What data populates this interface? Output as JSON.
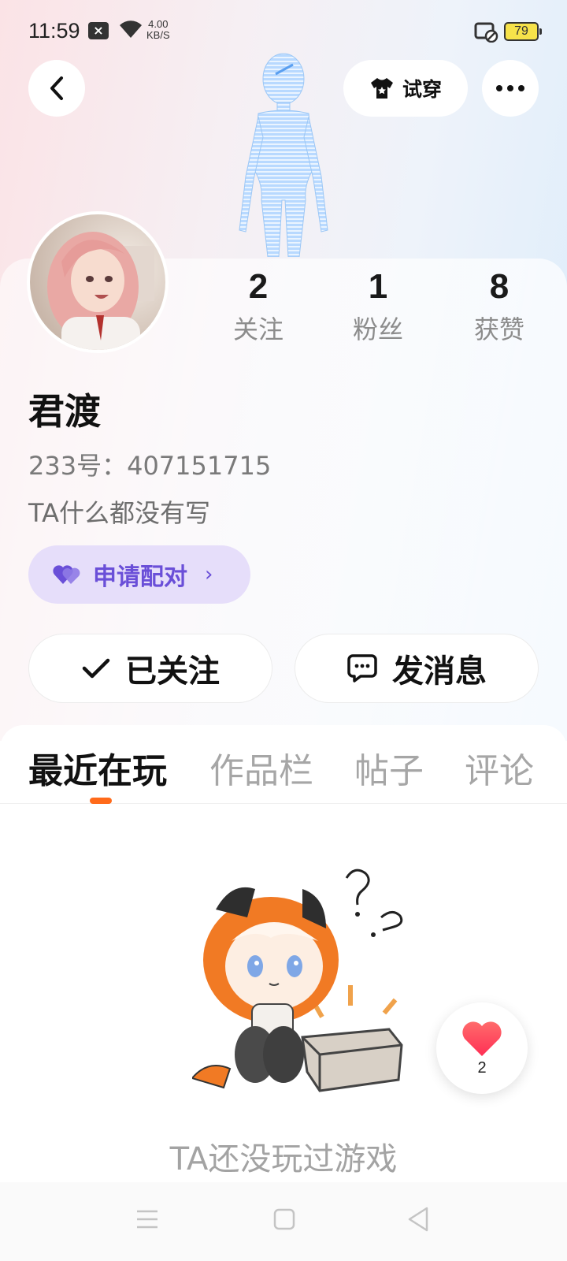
{
  "status_bar": {
    "time": "11:59",
    "notification_badge": "×",
    "speed_value": "4.00",
    "speed_unit": "KB/S",
    "battery": "79"
  },
  "header": {
    "tryon_label": "试穿"
  },
  "profile": {
    "username": "君渡",
    "uid": "233号：407151715",
    "bio": "TA什么都没有写",
    "pair_label": "申请配对",
    "stats": [
      {
        "value": "2",
        "label": "关注"
      },
      {
        "value": "1",
        "label": "粉丝"
      },
      {
        "value": "8",
        "label": "获赞"
      }
    ]
  },
  "actions": {
    "follow_label": "已关注",
    "message_label": "发消息"
  },
  "tabs": [
    {
      "label": "最近在玩",
      "active": true
    },
    {
      "label": "作品栏",
      "active": false
    },
    {
      "label": "帖子",
      "active": false
    },
    {
      "label": "评论",
      "active": false
    }
  ],
  "empty_state": {
    "text": "TA还没玩过游戏"
  },
  "like_widget": {
    "count": "2"
  },
  "colors": {
    "accent": "#ff6a1a",
    "pair_text": "#6a4fd8",
    "pair_bg": "#e6defa"
  }
}
